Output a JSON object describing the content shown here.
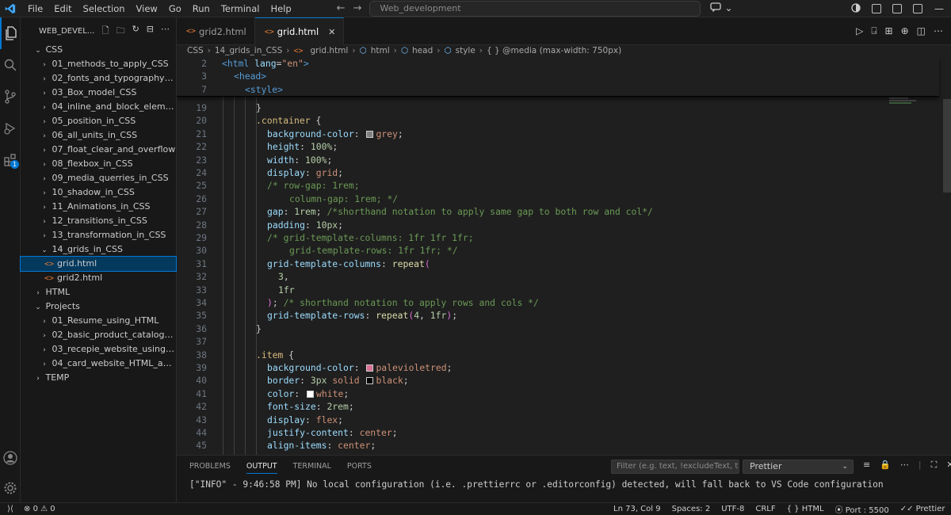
{
  "menu": [
    "File",
    "Edit",
    "Selection",
    "View",
    "Go",
    "Run",
    "Terminal",
    "Help"
  ],
  "command_center": "Web_development",
  "explorer": {
    "title": "WEB_DEVEL...",
    "root_css": "CSS",
    "css_folders": [
      "01_methods_to_apply_CSS",
      "02_fonts_and_typography_CSS",
      "03_Box_model_CSS",
      "04_inline_and_block_elements_...",
      "05_position_in_CSS",
      "06_all_units_in_CSS",
      "07_float_clear_and_overflow",
      "08_flexbox_in_CSS",
      "09_media_querries_in_CSS",
      "10_shadow_in_CSS",
      "11_Animations_in_CSS",
      "12_transitions_in_CSS",
      "13_transformation_in_CSS",
      "14_grids_in_CSS"
    ],
    "files": [
      "grid.html",
      "grid2.html"
    ],
    "html_folder": "HTML",
    "projects_folder": "Projects",
    "project_items": [
      "01_Resume_using_HTML",
      "02_basic_product_catalog_HTML",
      "03_recepie_website_using_HTM...",
      "04_card_website_HTML_and_CSS"
    ],
    "temp_folder": "TEMP",
    "extensions_badge": "1"
  },
  "tabs": [
    {
      "label": "grid2.html",
      "active": false
    },
    {
      "label": "grid.html",
      "active": true
    }
  ],
  "breadcrumb": [
    "CSS",
    "14_grids_in_CSS",
    "grid.html",
    "html",
    "head",
    "style",
    "{ } @media (max-width: 750px)"
  ],
  "sticky_lines": [
    {
      "num": "2",
      "text": "<html lang=\"en\">"
    },
    {
      "num": "3",
      "text": "<head>"
    },
    {
      "num": "7",
      "text": "<style>"
    }
  ],
  "code_lines": [
    {
      "num": "19",
      "text": "}"
    },
    {
      "num": "20",
      "text": ".container {"
    },
    {
      "num": "21",
      "text": "background-color: grey;"
    },
    {
      "num": "22",
      "text": "height: 100%;"
    },
    {
      "num": "23",
      "text": "width: 100%;"
    },
    {
      "num": "24",
      "text": "display: grid;"
    },
    {
      "num": "25",
      "text": "/* row-gap: 1rem;"
    },
    {
      "num": "26",
      "text": "column-gap: 1rem; */"
    },
    {
      "num": "27",
      "text": "gap: 1rem; /*shorthand notation to apply same gap to both row and col*/"
    },
    {
      "num": "28",
      "text": "padding: 10px;"
    },
    {
      "num": "29",
      "text": "/* grid-template-columns: 1fr 1fr 1fr;"
    },
    {
      "num": "30",
      "text": "grid-template-rows: 1fr 1fr; */"
    },
    {
      "num": "31",
      "text": "grid-template-columns: repeat("
    },
    {
      "num": "32",
      "text": "3,"
    },
    {
      "num": "33",
      "text": "1fr"
    },
    {
      "num": "34",
      "text": "); /* shorthand notation to apply rows and cols */"
    },
    {
      "num": "35",
      "text": "grid-template-rows: repeat(4, 1fr);"
    },
    {
      "num": "36",
      "text": "}"
    },
    {
      "num": "37",
      "text": ""
    },
    {
      "num": "38",
      "text": ".item {"
    },
    {
      "num": "39",
      "text": "background-color: palevioletred;"
    },
    {
      "num": "40",
      "text": "border: 3px solid black;"
    },
    {
      "num": "41",
      "text": "color: white;"
    },
    {
      "num": "42",
      "text": "font-size: 2rem;"
    },
    {
      "num": "43",
      "text": "display: flex;"
    },
    {
      "num": "44",
      "text": "justify-content: center;"
    },
    {
      "num": "45",
      "text": "align-items: center;"
    }
  ],
  "swatches": {
    "grey": "#808080",
    "palevioletred": "#db7093",
    "black": "#000000",
    "white": "#ffffff"
  },
  "panel": {
    "tabs": [
      "PROBLEMS",
      "OUTPUT",
      "TERMINAL",
      "PORTS"
    ],
    "active_tab": "OUTPUT",
    "filter_placeholder": "Filter (e.g. text, !excludeText, t...",
    "channel": "Prettier",
    "output": "[\"INFO\" - 9:46:58 PM] No local configuration (i.e. .prettierrc or .editorconfig) detected, will fall back to VS Code configuration"
  },
  "status": {
    "errors": "0",
    "warnings": "0",
    "position": "Ln 73, Col 9",
    "spaces": "Spaces: 2",
    "encoding": "UTF-8",
    "eol": "CRLF",
    "language": "HTML",
    "port": "Port : 5500",
    "formatter": "Prettier"
  },
  "colors": {
    "accent": "#0078d4",
    "background": "#1f1f1f",
    "sidebar": "#181818"
  }
}
